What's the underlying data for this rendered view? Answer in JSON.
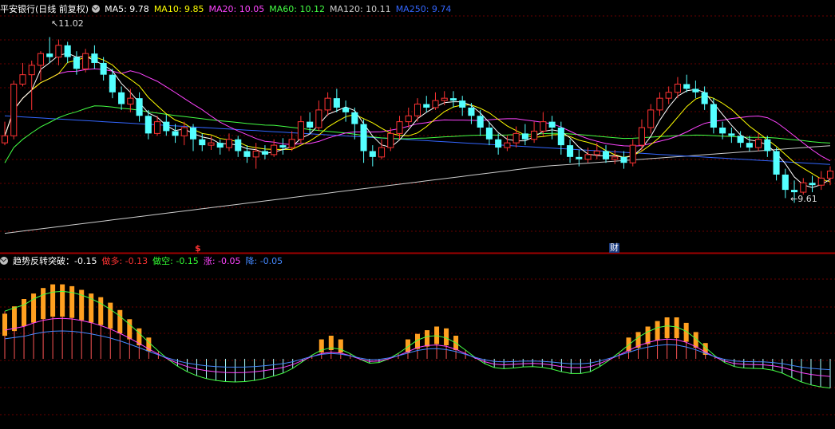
{
  "header": {
    "title": "平安银行(日线 前复权)",
    "ma": [
      {
        "label": "MA5: 9.78",
        "color": "#ffffff"
      },
      {
        "label": "MA10: 9.85",
        "color": "#ffff00"
      },
      {
        "label": "MA20: 10.05",
        "color": "#ff44ff"
      },
      {
        "label": "MA60: 10.12",
        "color": "#44ff44"
      },
      {
        "label": "MA120: 10.11",
        "color": "#cccccc"
      },
      {
        "label": "MA250: 9.74",
        "color": "#3366ff"
      }
    ]
  },
  "price_labels": {
    "high": "11.02",
    "low": "9.61"
  },
  "markers": {
    "dividend": "$",
    "finance": "财"
  },
  "indicator": {
    "name": "趋势反转突破：",
    "value": "-0.15",
    "items": [
      {
        "label": "做多",
        "value": "-0.13",
        "color": "#ff3333"
      },
      {
        "label": "做空",
        "value": "-0.15",
        "color": "#33ff33"
      },
      {
        "label": "涨",
        "value": "-0.05",
        "color": "#ff44ff"
      },
      {
        "label": "降",
        "value": "-0.05",
        "color": "#4488ff"
      }
    ]
  },
  "colors": {
    "up": "#ff3333",
    "down": "#54ffff",
    "grid": "#6a0000",
    "bar": "#ffa020"
  },
  "chart_data": {
    "type": "candlestick",
    "price_range": [
      9.3,
      11.2
    ],
    "candles": [
      [
        10.12,
        10.18,
        10.3,
        10.1
      ],
      [
        10.18,
        10.62,
        10.65,
        10.15
      ],
      [
        10.62,
        10.7,
        10.8,
        10.6
      ],
      [
        10.7,
        10.78,
        10.82,
        10.4
      ],
      [
        10.78,
        10.88,
        10.9,
        10.65
      ],
      [
        10.88,
        10.85,
        11.02,
        10.8
      ],
      [
        10.85,
        10.95,
        11.0,
        10.78
      ],
      [
        10.95,
        10.85,
        10.98,
        10.8
      ],
      [
        10.85,
        10.75,
        10.9,
        10.7
      ],
      [
        10.75,
        10.88,
        10.92,
        10.72
      ],
      [
        10.88,
        10.8,
        10.95,
        10.75
      ],
      [
        10.8,
        10.7,
        10.85,
        10.65
      ],
      [
        10.7,
        10.55,
        10.75,
        10.5
      ],
      [
        10.55,
        10.45,
        10.6,
        10.4
      ],
      [
        10.45,
        10.5,
        10.58,
        10.38
      ],
      [
        10.5,
        10.35,
        10.55,
        10.3
      ],
      [
        10.35,
        10.2,
        10.4,
        10.15
      ],
      [
        10.2,
        10.3,
        10.35,
        10.18
      ],
      [
        10.3,
        10.22,
        10.36,
        10.18
      ],
      [
        10.22,
        10.18,
        10.28,
        10.12
      ],
      [
        10.18,
        10.25,
        10.3,
        10.1
      ],
      [
        10.25,
        10.15,
        10.28,
        10.05
      ],
      [
        10.15,
        10.1,
        10.2,
        10.05
      ],
      [
        10.1,
        10.12,
        10.18,
        10.06
      ],
      [
        10.12,
        10.08,
        10.15,
        10.02
      ],
      [
        10.08,
        10.15,
        10.2,
        10.05
      ],
      [
        10.15,
        10.05,
        10.18,
        10.0
      ],
      [
        10.05,
        10.0,
        10.1,
        9.95
      ],
      [
        10.0,
        10.05,
        10.12,
        9.9
      ],
      [
        10.05,
        10.02,
        10.1,
        9.98
      ],
      [
        10.02,
        10.1,
        10.15,
        10.0
      ],
      [
        10.1,
        10.08,
        10.16,
        10.02
      ],
      [
        10.08,
        10.15,
        10.22,
        10.05
      ],
      [
        10.15,
        10.3,
        10.35,
        10.12
      ],
      [
        10.3,
        10.25,
        10.38,
        10.2
      ],
      [
        10.25,
        10.4,
        10.48,
        10.22
      ],
      [
        10.4,
        10.5,
        10.55,
        10.35
      ],
      [
        10.5,
        10.42,
        10.58,
        10.38
      ],
      [
        10.42,
        10.38,
        10.48,
        10.3
      ],
      [
        10.38,
        10.28,
        10.42,
        10.15
      ],
      [
        10.28,
        10.05,
        10.32,
        9.95
      ],
      [
        10.05,
        10.0,
        10.1,
        9.92
      ],
      [
        10.0,
        10.08,
        10.15,
        9.98
      ],
      [
        10.08,
        10.2,
        10.25,
        10.05
      ],
      [
        10.2,
        10.3,
        10.35,
        10.15
      ],
      [
        10.3,
        10.35,
        10.42,
        10.25
      ],
      [
        10.35,
        10.45,
        10.5,
        10.3
      ],
      [
        10.45,
        10.42,
        10.52,
        10.38
      ],
      [
        10.42,
        10.48,
        10.55,
        10.4
      ],
      [
        10.48,
        10.5,
        10.56,
        10.44
      ],
      [
        10.5,
        10.48,
        10.56,
        10.42
      ],
      [
        10.48,
        10.42,
        10.52,
        10.35
      ],
      [
        10.42,
        10.35,
        10.46,
        10.28
      ],
      [
        10.35,
        10.25,
        10.4,
        10.18
      ],
      [
        10.25,
        10.15,
        10.3,
        10.1
      ],
      [
        10.15,
        10.08,
        10.2,
        10.02
      ],
      [
        10.08,
        10.12,
        10.18,
        10.05
      ],
      [
        10.12,
        10.2,
        10.26,
        10.08
      ],
      [
        10.2,
        10.15,
        10.28,
        10.1
      ],
      [
        10.15,
        10.22,
        10.3,
        10.12
      ],
      [
        10.22,
        10.3,
        10.38,
        10.18
      ],
      [
        10.3,
        10.25,
        10.35,
        10.15
      ],
      [
        10.25,
        10.1,
        10.3,
        10.02
      ],
      [
        10.1,
        10.0,
        10.15,
        9.95
      ],
      [
        10.0,
        9.98,
        10.06,
        9.92
      ],
      [
        9.98,
        10.02,
        10.08,
        9.95
      ],
      [
        10.02,
        10.05,
        10.12,
        9.98
      ],
      [
        10.05,
        9.98,
        10.1,
        9.95
      ],
      [
        9.98,
        10.0,
        10.06,
        9.94
      ],
      [
        10.0,
        9.95,
        10.05,
        9.9
      ],
      [
        9.95,
        10.1,
        10.15,
        9.92
      ],
      [
        10.1,
        10.25,
        10.32,
        10.05
      ],
      [
        10.25,
        10.4,
        10.45,
        10.2
      ],
      [
        10.4,
        10.5,
        10.55,
        10.35
      ],
      [
        10.5,
        10.55,
        10.6,
        10.45
      ],
      [
        10.55,
        10.62,
        10.68,
        10.5
      ],
      [
        10.62,
        10.58,
        10.7,
        10.55
      ],
      [
        10.58,
        10.55,
        10.65,
        10.5
      ],
      [
        10.55,
        10.45,
        10.6,
        10.4
      ],
      [
        10.45,
        10.25,
        10.5,
        10.2
      ],
      [
        10.25,
        10.2,
        10.3,
        10.15
      ],
      [
        10.2,
        10.18,
        10.25,
        10.12
      ],
      [
        10.18,
        10.12,
        10.22,
        10.08
      ],
      [
        10.12,
        10.08,
        10.18,
        10.05
      ],
      [
        10.08,
        10.15,
        10.2,
        10.05
      ],
      [
        10.15,
        10.05,
        10.18,
        10.0
      ],
      [
        10.05,
        9.85,
        10.08,
        9.8
      ],
      [
        9.85,
        9.72,
        9.9,
        9.65
      ],
      [
        9.72,
        9.7,
        9.8,
        9.61
      ],
      [
        9.7,
        9.78,
        9.82,
        9.68
      ],
      [
        9.78,
        9.76,
        9.84,
        9.7
      ],
      [
        9.76,
        9.82,
        9.88,
        9.72
      ],
      [
        9.82,
        9.88,
        9.92,
        9.76
      ]
    ],
    "histogram": [
      0.22,
      0.26,
      0.3,
      0.33,
      0.36,
      0.38,
      0.38,
      0.37,
      0.35,
      0.33,
      0.31,
      0.28,
      0.24,
      0.19,
      0.14,
      0.09,
      0.04,
      -0.01,
      -0.05,
      -0.08,
      -0.1,
      -0.11,
      -0.12,
      -0.13,
      -0.13,
      -0.13,
      -0.12,
      -0.11,
      -0.1,
      -0.08,
      -0.06,
      -0.04,
      0.02,
      0.08,
      0.1,
      0.08,
      0.02,
      -0.02,
      -0.04,
      -0.05,
      -0.03,
      0.04,
      0.08,
      0.11,
      0.13,
      0.15,
      0.14,
      0.1,
      0.05,
      -0.01,
      -0.04,
      -0.06,
      -0.07,
      -0.06,
      -0.04,
      -0.02,
      -0.03,
      -0.06,
      -0.08,
      -0.09,
      -0.09,
      -0.08,
      -0.06,
      -0.03,
      0.05,
      0.09,
      0.12,
      0.15,
      0.18,
      0.2,
      0.2,
      0.17,
      0.12,
      0.06,
      0.0,
      -0.04,
      -0.06,
      -0.06,
      -0.05,
      -0.04,
      -0.05,
      -0.07,
      -0.1,
      -0.13,
      -0.16,
      -0.17,
      -0.15
    ]
  }
}
